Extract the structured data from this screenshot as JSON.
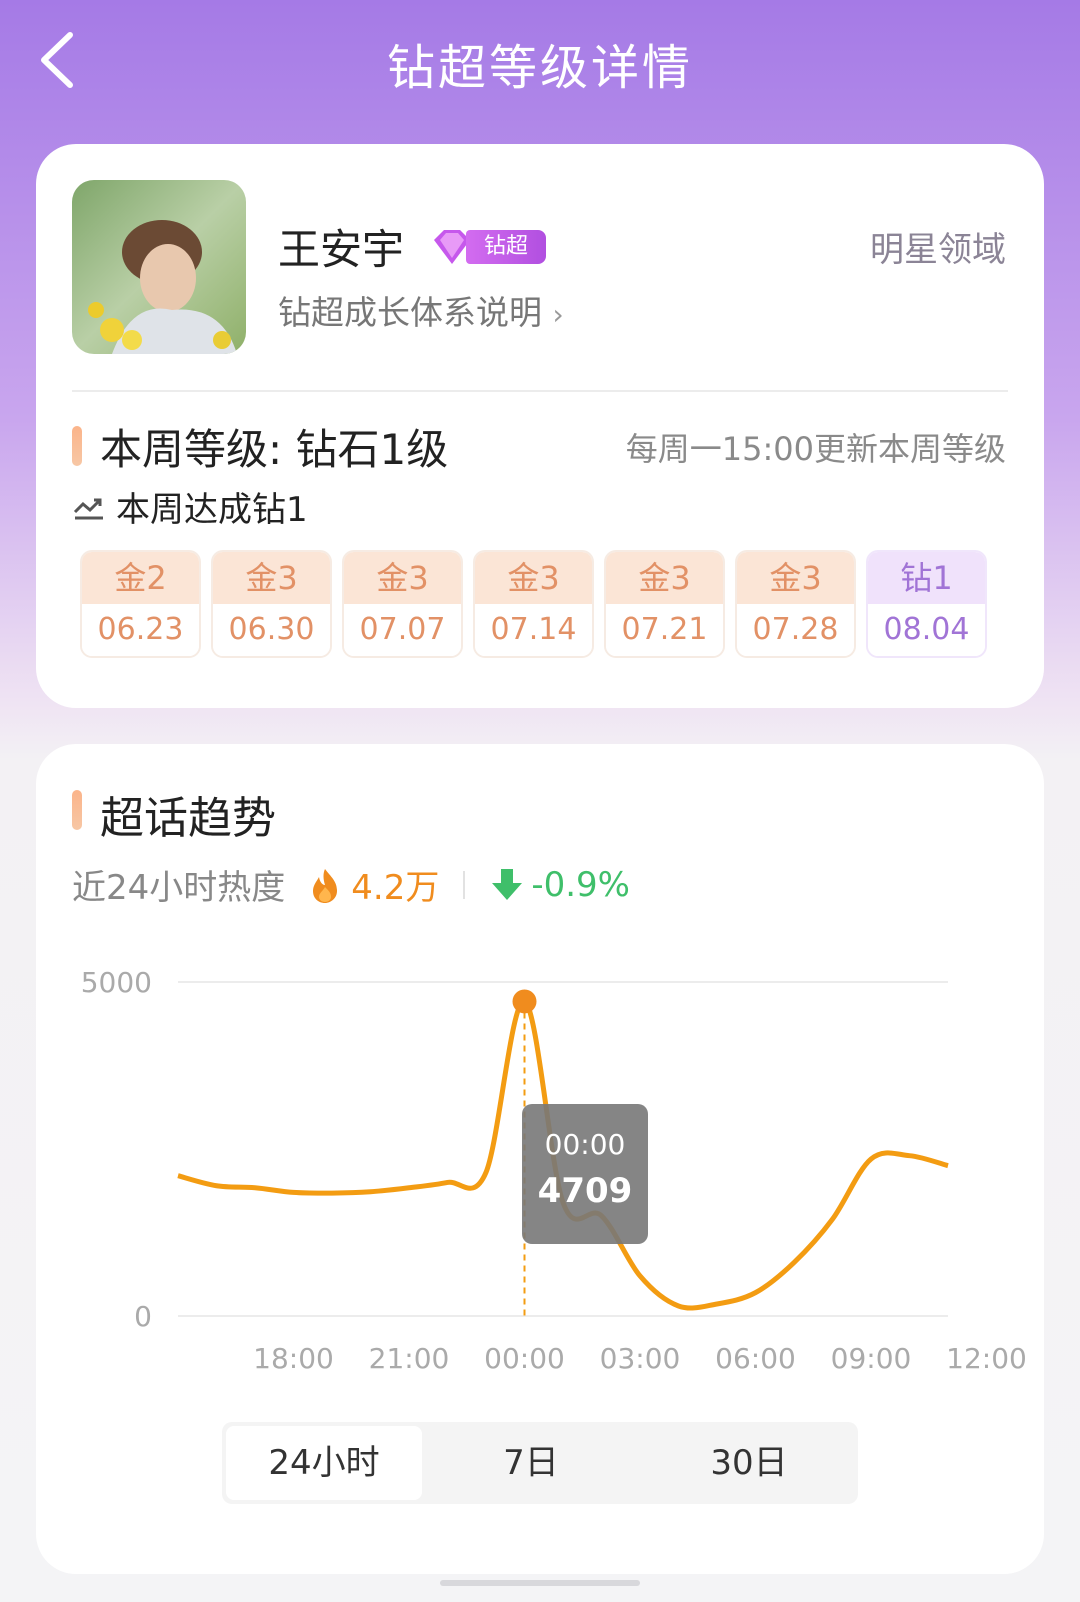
{
  "header": {
    "title": "钻超等级详情"
  },
  "profile": {
    "name": "王安宇",
    "badge": "钻超",
    "growth_link": "钻超成长体系说明",
    "domain_tag": "明星领域"
  },
  "level": {
    "current": "本周等级: 钻石1级",
    "update_note": "每周一15:00更新本周等级",
    "achieve": "本周达成钻1",
    "history": [
      {
        "level": "金2",
        "date": "06.23",
        "kind": "gold"
      },
      {
        "level": "金3",
        "date": "06.30",
        "kind": "gold"
      },
      {
        "level": "金3",
        "date": "07.07",
        "kind": "gold"
      },
      {
        "level": "金3",
        "date": "07.14",
        "kind": "gold"
      },
      {
        "level": "金3",
        "date": "07.21",
        "kind": "gold"
      },
      {
        "level": "金3",
        "date": "07.28",
        "kind": "gold"
      },
      {
        "level": "钻1",
        "date": "08.04",
        "kind": "diamond"
      }
    ]
  },
  "trend": {
    "title": "超话趋势",
    "heat_label": "近24小时热度",
    "heat_value": "4.2万",
    "change": "-0.9%",
    "tooltip": {
      "time": "00:00",
      "value": "4709"
    },
    "tabs": [
      "24小时",
      "7日",
      "30日"
    ],
    "active_tab": 0
  },
  "chart_data": {
    "type": "line",
    "ylim": [
      0,
      5000
    ],
    "y_ticks": [
      "5000",
      "0"
    ],
    "x_ticks": [
      "18:00",
      "21:00",
      "00:00",
      "03:00",
      "06:00",
      "09:00",
      "12:00"
    ],
    "x_range": [
      15,
      35
    ],
    "grid": true,
    "color": "#f39c12",
    "highlight": {
      "x": 24,
      "y": 4709
    },
    "points": [
      [
        15,
        2100
      ],
      [
        16,
        1950
      ],
      [
        17,
        1920
      ],
      [
        18,
        1850
      ],
      [
        19,
        1840
      ],
      [
        20,
        1860
      ],
      [
        21,
        1920
      ],
      [
        22,
        2000
      ],
      [
        23,
        2150
      ],
      [
        24,
        4709
      ],
      [
        25,
        1700
      ],
      [
        26,
        1500
      ],
      [
        27,
        600
      ],
      [
        28,
        150
      ],
      [
        29,
        180
      ],
      [
        30,
        350
      ],
      [
        31,
        800
      ],
      [
        32,
        1450
      ],
      [
        33,
        2350
      ],
      [
        34,
        2400
      ],
      [
        35,
        2250
      ]
    ]
  },
  "colors": {
    "accent_gold": "#e29166",
    "accent_diamond": "#a174d6",
    "line": "#f39c12",
    "down": "#3fbf6a"
  }
}
